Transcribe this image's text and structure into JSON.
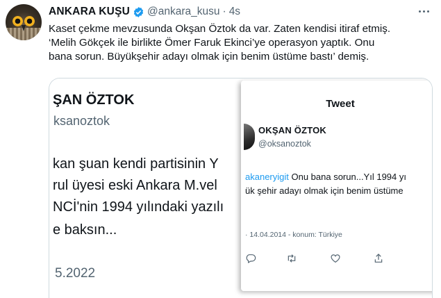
{
  "author": {
    "name": "ANKARA KUŞU",
    "handle": "@ankara_kusu",
    "separator": "·",
    "time": "4s",
    "verified_color": "#1d9bf0"
  },
  "tweet": {
    "text": "Kaset çekme mevzusunda Okşan Öztok da var. Zaten kendisi itiraf etmiş.\n‘Melih Gökçek ile birlikte Ömer Faruk Ekinci’ye operasyon yaptık. Onu\nbana sorun. Büyükşehir adayı olmak için benim üstüme bastı’ demiş."
  },
  "media": {
    "left_screenshot": {
      "name": "ŞAN ÖZTOK",
      "handle": "ksanoztok",
      "lines": [
        "kan şuan kendi partisinin Y",
        "rul üyesi eski Ankara M.vel",
        "NCİ'nin 1994 yılındaki yazılı",
        "e baksın..."
      ],
      "date": "5.2022"
    },
    "right_screenshot": {
      "title": "Tweet",
      "name": "OKŞAN ÖZTOK",
      "handle": "@oksanoztok",
      "mention": "akaneryigit",
      "line1_rest": " Onu bana sorun...Yıl 1994 yı",
      "line2": "ük şehir adayı olmak için benim üstüme",
      "meta": "· 14.04.2014 - konum: Türkiye",
      "actions": [
        "reply-icon",
        "retweet-icon",
        "like-icon",
        "share-icon"
      ]
    }
  }
}
